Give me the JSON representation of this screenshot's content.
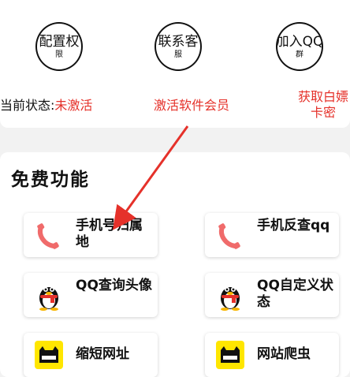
{
  "top": {
    "buttons": [
      {
        "line1": "配置权",
        "line2": "限"
      },
      {
        "line1": "联系客",
        "line2": "服"
      },
      {
        "line1": "加入QQ",
        "line2": "群"
      }
    ],
    "status_prefix": "当前状态:",
    "status_value": "未激活",
    "activate_label": "激活软件会员",
    "whitecard_line1": "获取白嫖",
    "whitecard_line2": "卡密"
  },
  "features": {
    "title": "免费功能",
    "items": [
      {
        "label": "手机号归属地",
        "icon": "phone-icon"
      },
      {
        "label": "手机反查qq",
        "icon": "phone-icon"
      },
      {
        "label": "QQ查询头像",
        "icon": "qq-penguin-icon"
      },
      {
        "label": "QQ自定义状态",
        "icon": "qq-penguin-icon"
      },
      {
        "label": "缩短网址",
        "icon": "yellow-cat-icon"
      },
      {
        "label": "网站爬虫",
        "icon": "yellow-cat-icon"
      }
    ]
  },
  "colors": {
    "accent_red": "#e5312a",
    "phone_icon": "#f06b6b",
    "yellow_icon": "#ffe600"
  }
}
